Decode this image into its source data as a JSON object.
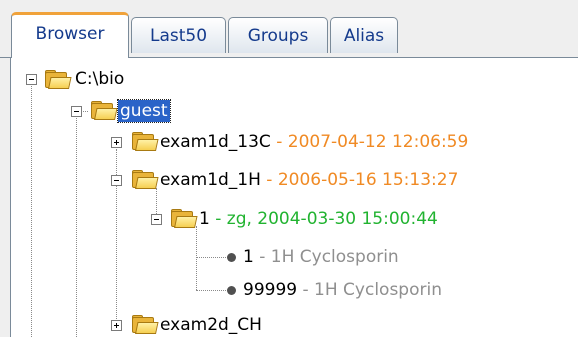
{
  "tabs": [
    {
      "label": "Browser",
      "active": true
    },
    {
      "label": "Last50"
    },
    {
      "label": "Groups"
    },
    {
      "label": "Alias"
    }
  ],
  "tree": {
    "root": {
      "name": "C:\\bio"
    },
    "guest": {
      "name": "guest"
    },
    "exam1d_13c": {
      "name": "exam1d_13C",
      "meta": " - 2007-04-12 12:06:59"
    },
    "exam1d_1h": {
      "name": "exam1d_1H",
      "meta": " - 2006-05-16 15:13:27"
    },
    "expno_1": {
      "name": "1",
      "meta": " - zg, 2004-03-30 15:00:44"
    },
    "proc_1": {
      "name": "1",
      "meta": " - 1H Cyclosporin"
    },
    "proc_99999": {
      "name": "99999",
      "meta": " - 1H Cyclosporin"
    },
    "exam2d_ch": {
      "name": "exam2d_CH"
    }
  },
  "colors": {
    "accent": "#f0a23a",
    "selection": "#2a63c8",
    "date": "#f08a24",
    "acq": "#21b330",
    "title": "#8f8f8f"
  }
}
